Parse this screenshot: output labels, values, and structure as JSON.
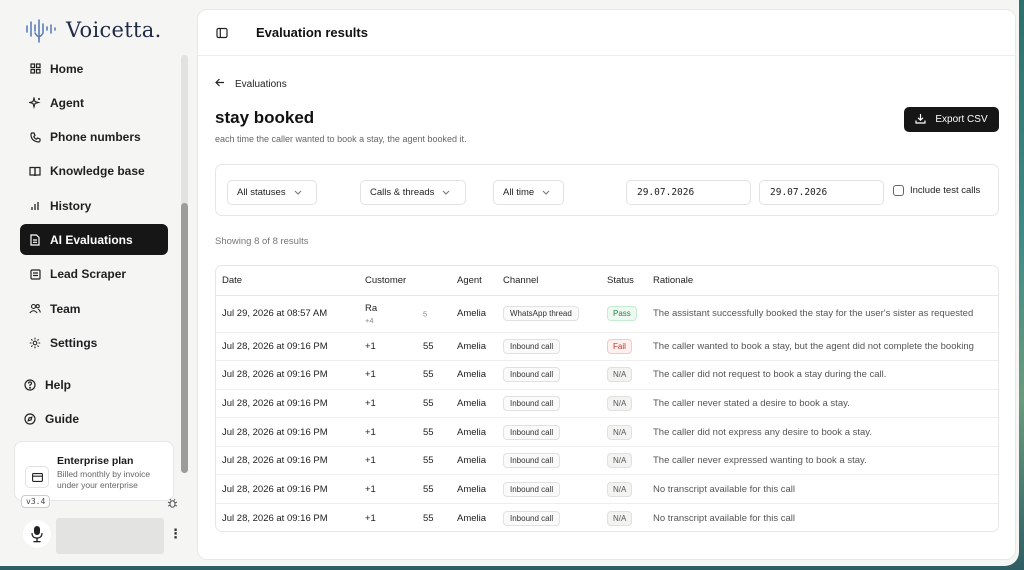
{
  "brand": {
    "name": "Voicetta."
  },
  "sidebar": {
    "items": [
      {
        "label": "Home",
        "icon": "grid-icon"
      },
      {
        "label": "Agent",
        "icon": "sparkles-icon"
      },
      {
        "label": "Phone numbers",
        "icon": "phone-icon"
      },
      {
        "label": "Knowledge base",
        "icon": "book-icon"
      },
      {
        "label": "History",
        "icon": "bar-chart-icon"
      },
      {
        "label": "AI Evaluations",
        "icon": "document-icon",
        "active": true
      },
      {
        "label": "Lead Scraper",
        "icon": "document-icon"
      },
      {
        "label": "Team",
        "icon": "users-icon"
      },
      {
        "label": "Settings",
        "icon": "gear-icon"
      }
    ],
    "lower": [
      {
        "label": "Help",
        "icon": "help-icon"
      },
      {
        "label": "Guide",
        "icon": "compass-icon"
      }
    ],
    "plan": {
      "title": "Enterprise plan",
      "description": "Billed monthly by invoice under your enterprise"
    },
    "version": "v3.4"
  },
  "topbar": {
    "title": "Evaluation results"
  },
  "page": {
    "back_label": "Evaluations",
    "title": "stay booked",
    "subtitle": "each time the caller wanted to book a stay, the agent booked it.",
    "export_label": "Export CSV",
    "filters": {
      "status": "All statuses",
      "channel": "Calls & threads",
      "time": "All time",
      "date_from": "29.07.2026",
      "date_to": "29.07.2026",
      "include_test_label": "Include test calls"
    },
    "showing": "Showing 8 of 8 results"
  },
  "table": {
    "headers": [
      "Date",
      "Customer",
      "Agent",
      "Channel",
      "Status",
      "Rationale"
    ],
    "rows": [
      {
        "date": "Jul 29, 2026 at 08:57 AM",
        "customer_a": "Ra",
        "customer_b": "+4",
        "customer_tail": "5",
        "agent": "Amelia",
        "channel": "WhatsApp thread",
        "status": "Pass",
        "rationale": "The assistant successfully booked the stay for the user's sister as requested"
      },
      {
        "date": "Jul 28, 2026 at 09:16 PM",
        "customer_a": "+1",
        "customer_b": "",
        "customer_tail": "55",
        "agent": "Amelia",
        "channel": "Inbound call",
        "status": "Fail",
        "rationale": "The caller wanted to book a stay, but the agent did not complete the booking"
      },
      {
        "date": "Jul 28, 2026 at 09:16 PM",
        "customer_a": "+1",
        "customer_b": "",
        "customer_tail": "55",
        "agent": "Amelia",
        "channel": "Inbound call",
        "status": "N/A",
        "rationale": "The caller did not request to book a stay during the call."
      },
      {
        "date": "Jul 28, 2026 at 09:16 PM",
        "customer_a": "+1",
        "customer_b": "",
        "customer_tail": "55",
        "agent": "Amelia",
        "channel": "Inbound call",
        "status": "N/A",
        "rationale": "The caller never stated a desire to book a stay."
      },
      {
        "date": "Jul 28, 2026 at 09:16 PM",
        "customer_a": "+1",
        "customer_b": "",
        "customer_tail": "55",
        "agent": "Amelia",
        "channel": "Inbound call",
        "status": "N/A",
        "rationale": "The caller did not express any desire to book a stay."
      },
      {
        "date": "Jul 28, 2026 at 09:16 PM",
        "customer_a": "+1",
        "customer_b": "",
        "customer_tail": "55",
        "agent": "Amelia",
        "channel": "Inbound call",
        "status": "N/A",
        "rationale": "The caller never expressed wanting to book a stay."
      },
      {
        "date": "Jul 28, 2026 at 09:16 PM",
        "customer_a": "+1",
        "customer_b": "",
        "customer_tail": "55",
        "agent": "Amelia",
        "channel": "Inbound call",
        "status": "N/A",
        "rationale": "No transcript available for this call"
      },
      {
        "date": "Jul 28, 2026 at 09:16 PM",
        "customer_a": "+1",
        "customer_b": "",
        "customer_tail": "55",
        "agent": "Amelia",
        "channel": "Inbound call",
        "status": "N/A",
        "rationale": "No transcript available for this call"
      }
    ]
  }
}
